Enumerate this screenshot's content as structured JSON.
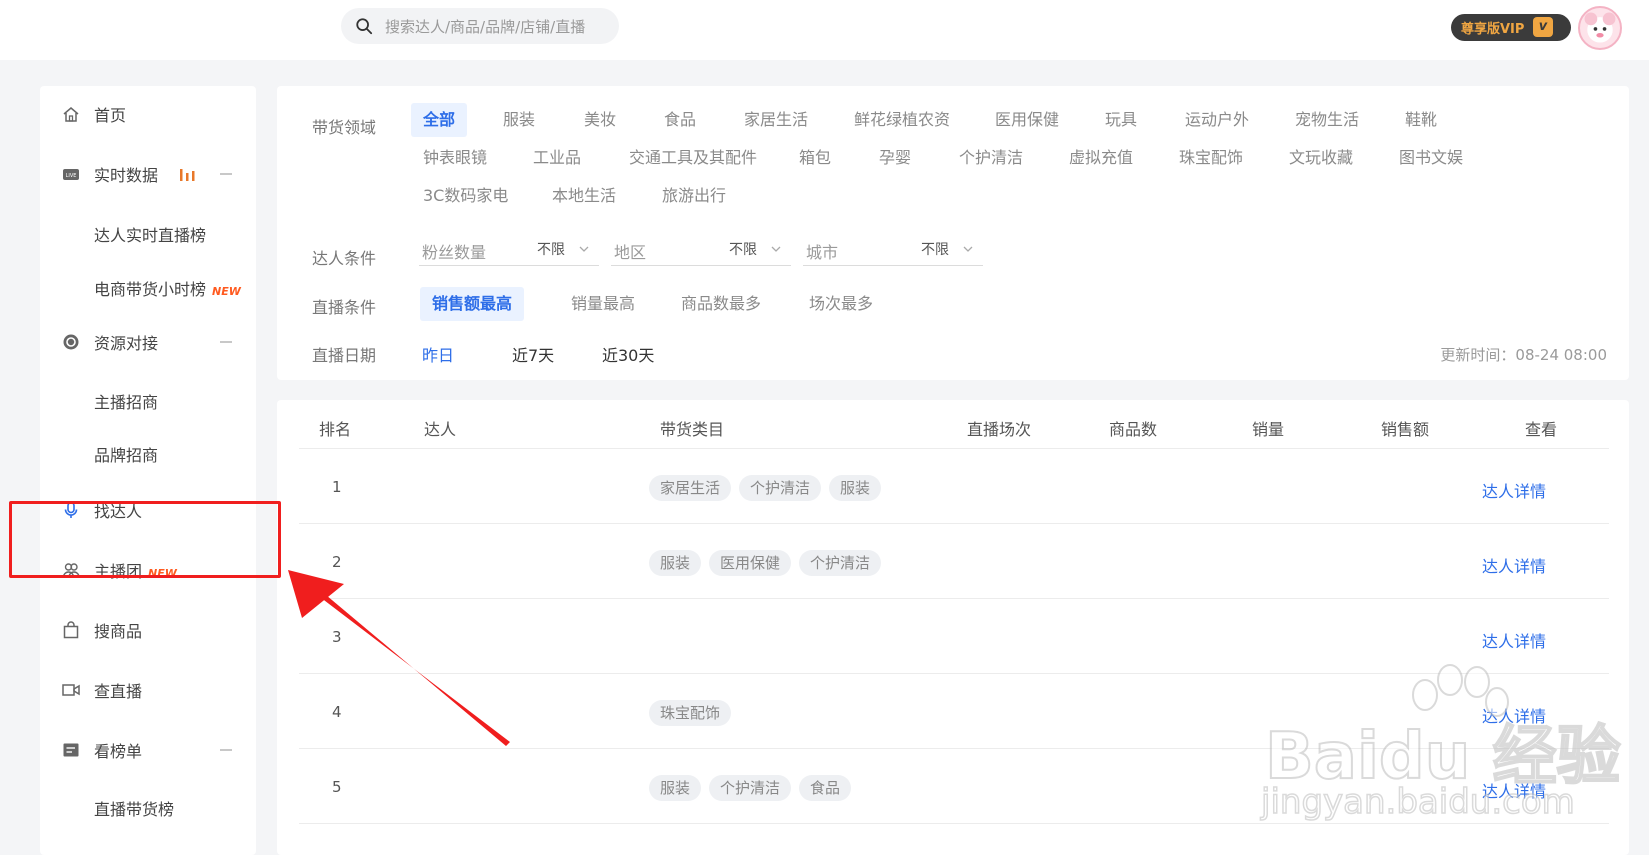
{
  "search": {
    "placeholder": "搜索达人/商品/品牌/店铺/直播"
  },
  "vip": {
    "label": "尊享版VIP",
    "mark": "v"
  },
  "sidebar": {
    "home": "首页",
    "realtime": "实时数据",
    "realtime_sub1": "达人实时直播榜",
    "realtime_sub2": "电商带货小时榜",
    "new": "NEW",
    "resource": "资源对接",
    "resource_sub1": "主播招商",
    "resource_sub2": "品牌招商",
    "find_talent": "找达人",
    "anchor_group": "主播团",
    "search_goods": "搜商品",
    "check_live": "查直播",
    "ranking": "看榜单",
    "ranking_sub1": "直播带货榜"
  },
  "filters": {
    "domain_label": "带货领域",
    "domains": [
      "全部",
      "服装",
      "美妆",
      "食品",
      "家居生活",
      "鲜花绿植农资",
      "医用保健",
      "玩具",
      "运动户外",
      "宠物生活",
      "鞋靴",
      "钟表眼镜",
      "工业品",
      "交通工具及其配件",
      "箱包",
      "孕婴",
      "个护清洁",
      "虚拟充值",
      "珠宝配饰",
      "文玩收藏",
      "图书文娱",
      "3C数码家电",
      "本地生活",
      "旅游出行"
    ],
    "talent_label": "达人条件",
    "talent_selects": [
      {
        "label": "粉丝数量",
        "value": "不限"
      },
      {
        "label": "地区",
        "value": "不限"
      },
      {
        "label": "城市",
        "value": "不限"
      }
    ],
    "live_label": "直播条件",
    "live_options": [
      "销售额最高",
      "销量最高",
      "商品数最多",
      "场次最多"
    ],
    "date_label": "直播日期",
    "date_options": [
      "昨日",
      "近7天",
      "近30天"
    ],
    "update_time": "更新时间：08-24 08:00"
  },
  "table": {
    "headers": [
      "排名",
      "达人",
      "带货类目",
      "直播场次",
      "商品数",
      "销量",
      "销售额",
      "查看"
    ],
    "detail_label": "达人详情",
    "rows": [
      {
        "rank": "1",
        "tags": [
          "家居生活",
          "个护清洁",
          "服装"
        ]
      },
      {
        "rank": "2",
        "tags": [
          "服装",
          "医用保健",
          "个护清洁"
        ]
      },
      {
        "rank": "3",
        "tags": []
      },
      {
        "rank": "4",
        "tags": [
          "珠宝配饰"
        ]
      },
      {
        "rank": "5",
        "tags": [
          "服装",
          "个护清洁",
          "食品"
        ]
      }
    ]
  },
  "watermark": {
    "logo": "Baidu 经验",
    "url": "jingyan.baidu.com"
  },
  "colors": {
    "accent": "#2e6ee8",
    "highlight": "#f01e1e",
    "new_badge": "#ff5a1f"
  }
}
